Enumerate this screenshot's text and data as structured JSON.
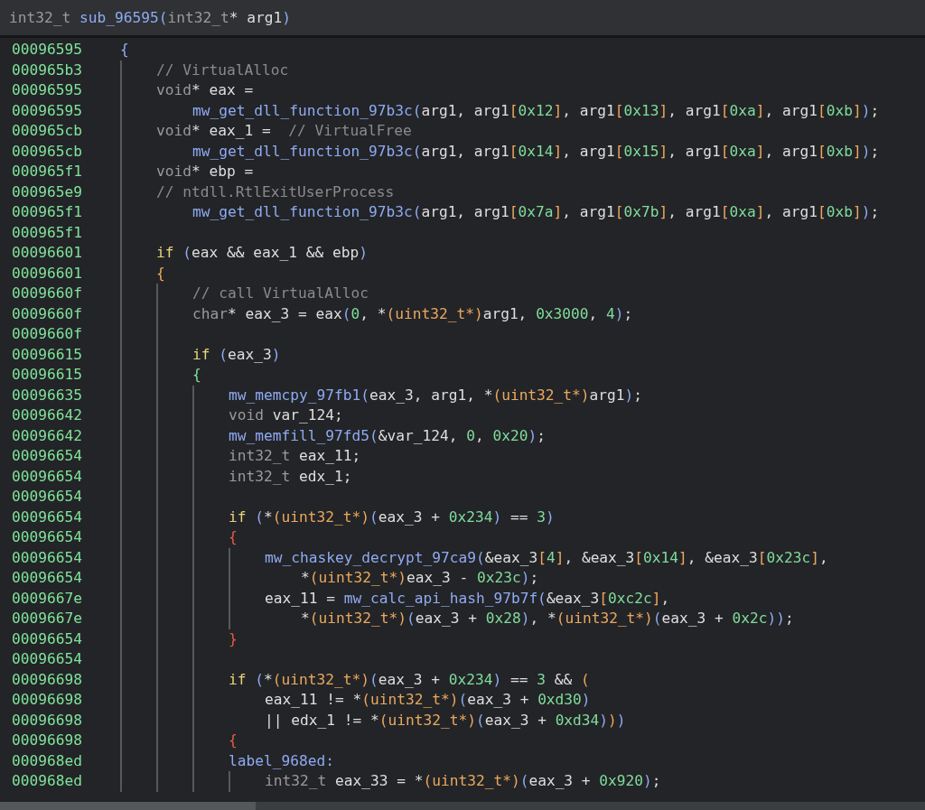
{
  "header": {
    "tokens": [
      {
        "kind": "type",
        "text": "int32_t "
      },
      {
        "kind": "fn",
        "text": "sub_96595("
      },
      {
        "kind": "type",
        "text": "int32_t"
      },
      {
        "kind": "plain",
        "text": "* arg1"
      },
      {
        "kind": "fn",
        "text": ")"
      }
    ]
  },
  "code": [
    {
      "kind": "line",
      "address": "00096595",
      "tokens": [
        {
          "kind": "fn",
          "text": "{"
        }
      ]
    },
    {
      "kind": "block",
      "children": [
        {
          "kind": "line",
          "address": "000965b3",
          "tokens": [
            {
              "kind": "comment",
              "text": "// VirtualAlloc"
            }
          ]
        },
        {
          "kind": "line",
          "address": "00096595",
          "tokens": [
            {
              "kind": "type",
              "text": "void"
            },
            {
              "kind": "plain",
              "text": "* eax ="
            }
          ]
        },
        {
          "kind": "continuation",
          "address": "00096595",
          "tokens": [
            {
              "kind": "fn",
              "text": "mw_get_dll_function_97b3c("
            },
            {
              "kind": "plain",
              "text": "arg1, arg1"
            },
            {
              "kind": "cast",
              "text": "["
            },
            {
              "kind": "num",
              "text": "0x12"
            },
            {
              "kind": "cast",
              "text": "]"
            },
            {
              "kind": "plain",
              "text": ", arg1"
            },
            {
              "kind": "cast",
              "text": "["
            },
            {
              "kind": "num",
              "text": "0x13"
            },
            {
              "kind": "cast",
              "text": "]"
            },
            {
              "kind": "plain",
              "text": ", arg1"
            },
            {
              "kind": "cast",
              "text": "["
            },
            {
              "kind": "num",
              "text": "0xa"
            },
            {
              "kind": "cast",
              "text": "]"
            },
            {
              "kind": "plain",
              "text": ", arg1"
            },
            {
              "kind": "cast",
              "text": "["
            },
            {
              "kind": "num",
              "text": "0xb"
            },
            {
              "kind": "cast",
              "text": "]"
            },
            {
              "kind": "fn",
              "text": ")"
            },
            {
              "kind": "plain",
              "text": ";"
            }
          ]
        },
        {
          "kind": "line",
          "address": "000965cb",
          "tokens": [
            {
              "kind": "type",
              "text": "void"
            },
            {
              "kind": "plain",
              "text": "* eax_1 =  "
            },
            {
              "kind": "comment",
              "text": "// VirtualFree"
            }
          ]
        },
        {
          "kind": "continuation",
          "address": "000965cb",
          "tokens": [
            {
              "kind": "fn",
              "text": "mw_get_dll_function_97b3c("
            },
            {
              "kind": "plain",
              "text": "arg1, arg1"
            },
            {
              "kind": "cast",
              "text": "["
            },
            {
              "kind": "num",
              "text": "0x14"
            },
            {
              "kind": "cast",
              "text": "]"
            },
            {
              "kind": "plain",
              "text": ", arg1"
            },
            {
              "kind": "cast",
              "text": "["
            },
            {
              "kind": "num",
              "text": "0x15"
            },
            {
              "kind": "cast",
              "text": "]"
            },
            {
              "kind": "plain",
              "text": ", arg1"
            },
            {
              "kind": "cast",
              "text": "["
            },
            {
              "kind": "num",
              "text": "0xa"
            },
            {
              "kind": "cast",
              "text": "]"
            },
            {
              "kind": "plain",
              "text": ", arg1"
            },
            {
              "kind": "cast",
              "text": "["
            },
            {
              "kind": "num",
              "text": "0xb"
            },
            {
              "kind": "cast",
              "text": "]"
            },
            {
              "kind": "fn",
              "text": ")"
            },
            {
              "kind": "plain",
              "text": ";"
            }
          ]
        },
        {
          "kind": "line",
          "address": "000965f1",
          "tokens": [
            {
              "kind": "type",
              "text": "void"
            },
            {
              "kind": "plain",
              "text": "* ebp ="
            }
          ]
        },
        {
          "kind": "line",
          "address": "000965e9",
          "tokens": [
            {
              "kind": "comment",
              "text": "// ntdll.RtlExitUserProcess"
            }
          ]
        },
        {
          "kind": "continuation",
          "address": "000965f1",
          "tokens": [
            {
              "kind": "fn",
              "text": "mw_get_dll_function_97b3c("
            },
            {
              "kind": "plain",
              "text": "arg1, arg1"
            },
            {
              "kind": "cast",
              "text": "["
            },
            {
              "kind": "num",
              "text": "0x7a"
            },
            {
              "kind": "cast",
              "text": "]"
            },
            {
              "kind": "plain",
              "text": ", arg1"
            },
            {
              "kind": "cast",
              "text": "["
            },
            {
              "kind": "num",
              "text": "0x7b"
            },
            {
              "kind": "cast",
              "text": "]"
            },
            {
              "kind": "plain",
              "text": ", arg1"
            },
            {
              "kind": "cast",
              "text": "["
            },
            {
              "kind": "num",
              "text": "0xa"
            },
            {
              "kind": "cast",
              "text": "]"
            },
            {
              "kind": "plain",
              "text": ", arg1"
            },
            {
              "kind": "cast",
              "text": "["
            },
            {
              "kind": "num",
              "text": "0xb"
            },
            {
              "kind": "cast",
              "text": "]"
            },
            {
              "kind": "fn",
              "text": ")"
            },
            {
              "kind": "plain",
              "text": ";"
            }
          ]
        },
        {
          "kind": "line",
          "address": "000965f1"
        },
        {
          "kind": "line",
          "address": "00096601",
          "tokens": [
            {
              "kind": "keyword",
              "text": "if "
            },
            {
              "kind": "fn",
              "text": "("
            },
            {
              "kind": "plain",
              "text": "eax && eax_1 && ebp"
            },
            {
              "kind": "fn",
              "text": ")"
            }
          ]
        },
        {
          "kind": "line",
          "address": "00096601",
          "tokens": [
            {
              "kind": "cast",
              "text": "{"
            }
          ]
        },
        {
          "kind": "block",
          "children": [
            {
              "kind": "line",
              "address": "0009660f",
              "tokens": [
                {
                  "kind": "comment",
                  "text": "// call VirtualAlloc"
                }
              ]
            },
            {
              "kind": "line",
              "address": "0009660f",
              "tokens": [
                {
                  "kind": "type",
                  "text": "char"
                },
                {
                  "kind": "plain",
                  "text": "* eax_3 = eax"
                },
                {
                  "kind": "fn",
                  "text": "("
                },
                {
                  "kind": "num",
                  "text": "0"
                },
                {
                  "kind": "plain",
                  "text": ", *"
                },
                {
                  "kind": "cast",
                  "text": "(uint32_t*)"
                },
                {
                  "kind": "plain",
                  "text": "arg1, "
                },
                {
                  "kind": "num",
                  "text": "0x3000"
                },
                {
                  "kind": "plain",
                  "text": ", "
                },
                {
                  "kind": "num",
                  "text": "4"
                },
                {
                  "kind": "fn",
                  "text": ")"
                },
                {
                  "kind": "plain",
                  "text": ";"
                }
              ]
            },
            {
              "kind": "line",
              "address": "0009660f"
            },
            {
              "kind": "line",
              "address": "00096615",
              "tokens": [
                {
                  "kind": "keyword",
                  "text": "if "
                },
                {
                  "kind": "fn",
                  "text": "("
                },
                {
                  "kind": "plain",
                  "text": "eax_3"
                },
                {
                  "kind": "fn",
                  "text": ")"
                }
              ]
            },
            {
              "kind": "line",
              "address": "00096615",
              "tokens": [
                {
                  "kind": "num",
                  "text": "{"
                }
              ]
            },
            {
              "kind": "block",
              "children": [
                {
                  "kind": "line",
                  "address": "00096635",
                  "tokens": [
                    {
                      "kind": "fn",
                      "text": "mw_memcpy_97fb1("
                    },
                    {
                      "kind": "plain",
                      "text": "eax_3, arg1, *"
                    },
                    {
                      "kind": "cast",
                      "text": "(uint32_t*)"
                    },
                    {
                      "kind": "plain",
                      "text": "arg1"
                    },
                    {
                      "kind": "fn",
                      "text": ")"
                    },
                    {
                      "kind": "plain",
                      "text": ";"
                    }
                  ]
                },
                {
                  "kind": "line",
                  "address": "00096642",
                  "tokens": [
                    {
                      "kind": "type",
                      "text": "void"
                    },
                    {
                      "kind": "plain",
                      "text": " var_124;"
                    }
                  ]
                },
                {
                  "kind": "line",
                  "address": "00096642",
                  "tokens": [
                    {
                      "kind": "fn",
                      "text": "mw_memfill_97fd5("
                    },
                    {
                      "kind": "plain",
                      "text": "&var_124, "
                    },
                    {
                      "kind": "num",
                      "text": "0"
                    },
                    {
                      "kind": "plain",
                      "text": ", "
                    },
                    {
                      "kind": "num",
                      "text": "0x20"
                    },
                    {
                      "kind": "fn",
                      "text": ")"
                    },
                    {
                      "kind": "plain",
                      "text": ";"
                    }
                  ]
                },
                {
                  "kind": "line",
                  "address": "00096654",
                  "tokens": [
                    {
                      "kind": "type",
                      "text": "int32_t"
                    },
                    {
                      "kind": "plain",
                      "text": " eax_11;"
                    }
                  ]
                },
                {
                  "kind": "line",
                  "address": "00096654",
                  "tokens": [
                    {
                      "kind": "type",
                      "text": "int32_t"
                    },
                    {
                      "kind": "plain",
                      "text": " edx_1;"
                    }
                  ]
                },
                {
                  "kind": "line",
                  "address": "00096654"
                },
                {
                  "kind": "line",
                  "address": "00096654",
                  "tokens": [
                    {
                      "kind": "keyword",
                      "text": "if "
                    },
                    {
                      "kind": "fn",
                      "text": "("
                    },
                    {
                      "kind": "plain",
                      "text": "*"
                    },
                    {
                      "kind": "cast",
                      "text": "(uint32_t*)"
                    },
                    {
                      "kind": "fn",
                      "text": "("
                    },
                    {
                      "kind": "plain",
                      "text": "eax_3 + "
                    },
                    {
                      "kind": "num",
                      "text": "0x234"
                    },
                    {
                      "kind": "fn",
                      "text": ")"
                    },
                    {
                      "kind": "plain",
                      "text": " == "
                    },
                    {
                      "kind": "num",
                      "text": "3"
                    },
                    {
                      "kind": "fn",
                      "text": ")"
                    }
                  ]
                },
                {
                  "kind": "line",
                  "address": "00096654",
                  "tokens": [
                    {
                      "kind": "brace",
                      "text": "{"
                    }
                  ]
                },
                {
                  "kind": "block",
                  "children": [
                    {
                      "kind": "line",
                      "address": "00096654",
                      "tokens": [
                        {
                          "kind": "fn",
                          "text": "mw_chaskey_decrypt_97ca9("
                        },
                        {
                          "kind": "plain",
                          "text": "&eax_3"
                        },
                        {
                          "kind": "cast",
                          "text": "["
                        },
                        {
                          "kind": "num",
                          "text": "4"
                        },
                        {
                          "kind": "cast",
                          "text": "]"
                        },
                        {
                          "kind": "plain",
                          "text": ", &eax_3"
                        },
                        {
                          "kind": "cast",
                          "text": "["
                        },
                        {
                          "kind": "num",
                          "text": "0x14"
                        },
                        {
                          "kind": "cast",
                          "text": "]"
                        },
                        {
                          "kind": "plain",
                          "text": ", &eax_3"
                        },
                        {
                          "kind": "cast",
                          "text": "["
                        },
                        {
                          "kind": "num",
                          "text": "0x23c"
                        },
                        {
                          "kind": "cast",
                          "text": "]"
                        },
                        {
                          "kind": "plain",
                          "text": ","
                        }
                      ]
                    },
                    {
                      "kind": "continuation",
                      "address": "00096654",
                      "tokens": [
                        {
                          "kind": "plain",
                          "text": "*"
                        },
                        {
                          "kind": "cast",
                          "text": "(uint32_t*)"
                        },
                        {
                          "kind": "plain",
                          "text": "eax_3 - "
                        },
                        {
                          "kind": "num",
                          "text": "0x23c"
                        },
                        {
                          "kind": "fn",
                          "text": ")"
                        },
                        {
                          "kind": "plain",
                          "text": ";"
                        }
                      ]
                    },
                    {
                      "kind": "line",
                      "address": "0009667e",
                      "tokens": [
                        {
                          "kind": "plain",
                          "text": "eax_11 = "
                        },
                        {
                          "kind": "fn",
                          "text": "mw_calc_api_hash_97b7f("
                        },
                        {
                          "kind": "plain",
                          "text": "&eax_3"
                        },
                        {
                          "kind": "cast",
                          "text": "["
                        },
                        {
                          "kind": "num",
                          "text": "0xc2c"
                        },
                        {
                          "kind": "cast",
                          "text": "]"
                        },
                        {
                          "kind": "plain",
                          "text": ","
                        }
                      ]
                    },
                    {
                      "kind": "continuation",
                      "address": "0009667e",
                      "tokens": [
                        {
                          "kind": "plain",
                          "text": "*"
                        },
                        {
                          "kind": "cast",
                          "text": "(uint32_t*)"
                        },
                        {
                          "kind": "fn",
                          "text": "("
                        },
                        {
                          "kind": "plain",
                          "text": "eax_3 + "
                        },
                        {
                          "kind": "num",
                          "text": "0x28"
                        },
                        {
                          "kind": "fn",
                          "text": ")"
                        },
                        {
                          "kind": "plain",
                          "text": ", *"
                        },
                        {
                          "kind": "cast",
                          "text": "(uint32_t*)"
                        },
                        {
                          "kind": "fn",
                          "text": "("
                        },
                        {
                          "kind": "plain",
                          "text": "eax_3 + "
                        },
                        {
                          "kind": "num",
                          "text": "0x2c"
                        },
                        {
                          "kind": "fn",
                          "text": "))"
                        },
                        {
                          "kind": "plain",
                          "text": ";"
                        }
                      ]
                    }
                  ]
                },
                {
                  "kind": "line",
                  "address": "00096654",
                  "tokens": [
                    {
                      "kind": "brace",
                      "text": "}"
                    }
                  ]
                },
                {
                  "kind": "line",
                  "address": "00096654"
                },
                {
                  "kind": "line",
                  "address": "00096698",
                  "tokens": [
                    {
                      "kind": "keyword",
                      "text": "if "
                    },
                    {
                      "kind": "fn",
                      "text": "("
                    },
                    {
                      "kind": "plain",
                      "text": "*"
                    },
                    {
                      "kind": "cast",
                      "text": "(uint32_t*)"
                    },
                    {
                      "kind": "fn",
                      "text": "("
                    },
                    {
                      "kind": "plain",
                      "text": "eax_3 + "
                    },
                    {
                      "kind": "num",
                      "text": "0x234"
                    },
                    {
                      "kind": "fn",
                      "text": ")"
                    },
                    {
                      "kind": "plain",
                      "text": " == "
                    },
                    {
                      "kind": "num",
                      "text": "3"
                    },
                    {
                      "kind": "plain",
                      "text": " && "
                    },
                    {
                      "kind": "cast",
                      "text": "("
                    }
                  ]
                },
                {
                  "kind": "continuation",
                  "address": "00096698",
                  "tokens": [
                    {
                      "kind": "plain",
                      "text": "eax_11 != *"
                    },
                    {
                      "kind": "cast",
                      "text": "(uint32_t*)"
                    },
                    {
                      "kind": "fn",
                      "text": "("
                    },
                    {
                      "kind": "plain",
                      "text": "eax_3 + "
                    },
                    {
                      "kind": "num",
                      "text": "0xd30"
                    },
                    {
                      "kind": "fn",
                      "text": ")"
                    }
                  ]
                },
                {
                  "kind": "continuation",
                  "address": "00096698",
                  "tokens": [
                    {
                      "kind": "plain",
                      "text": "|| edx_1 != *"
                    },
                    {
                      "kind": "cast",
                      "text": "(uint32_t*)"
                    },
                    {
                      "kind": "fn",
                      "text": "("
                    },
                    {
                      "kind": "plain",
                      "text": "eax_3 + "
                    },
                    {
                      "kind": "num",
                      "text": "0xd34"
                    },
                    {
                      "kind": "fn",
                      "text": ")"
                    },
                    {
                      "kind": "cast",
                      "text": ")"
                    },
                    {
                      "kind": "fn",
                      "text": ")"
                    }
                  ]
                },
                {
                  "kind": "line",
                  "address": "00096698",
                  "tokens": [
                    {
                      "kind": "brace",
                      "text": "{"
                    }
                  ]
                },
                {
                  "kind": "line",
                  "address": "000968ed",
                  "tokens": [
                    {
                      "kind": "fn",
                      "text": "label_968ed:"
                    }
                  ]
                },
                {
                  "kind": "block",
                  "children": [
                    {
                      "kind": "line",
                      "address": "000968ed",
                      "tokens": [
                        {
                          "kind": "type",
                          "text": "int32_t"
                        },
                        {
                          "kind": "plain",
                          "text": " eax_33 = *"
                        },
                        {
                          "kind": "cast",
                          "text": "(uint32_t*)"
                        },
                        {
                          "kind": "fn",
                          "text": "("
                        },
                        {
                          "kind": "plain",
                          "text": "eax_3 + "
                        },
                        {
                          "kind": "num",
                          "text": "0x920"
                        },
                        {
                          "kind": "fn",
                          "text": ")"
                        },
                        {
                          "kind": "plain",
                          "text": ";"
                        }
                      ]
                    }
                  ]
                }
              ]
            }
          ]
        }
      ]
    }
  ]
}
